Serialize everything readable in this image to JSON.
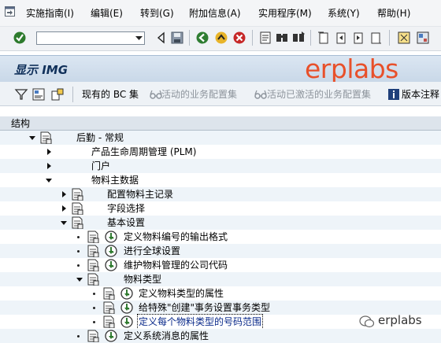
{
  "menu": {
    "items": [
      {
        "label": "实施指南(I)"
      },
      {
        "label": "编辑(E)"
      },
      {
        "label": "转到(G)"
      },
      {
        "label": "附加信息(A)"
      },
      {
        "label": "实用程序(M)"
      },
      {
        "label": "系统(Y)"
      },
      {
        "label": "帮助(H)"
      }
    ]
  },
  "command_field": {
    "value": ""
  },
  "title": "显示 IMG",
  "watermark": "erplabs",
  "app_toolbar": {
    "bc_sets": "现有的 BC 集",
    "active_bc_sets": "活动的业务配置集",
    "activated_bc_sets": "活动已激活的业务配置集",
    "release_notes": "版本注释"
  },
  "tree": {
    "header": "结构",
    "rows": [
      {
        "label": "后勤 - 常规"
      },
      {
        "label": "产品生命周期管理 (PLM)"
      },
      {
        "label": "门户"
      },
      {
        "label": "物料主数据"
      },
      {
        "label": "配置物料主记录"
      },
      {
        "label": "字段选择"
      },
      {
        "label": "基本设置"
      },
      {
        "label": "定义物料编号的输出格式"
      },
      {
        "label": "进行全球设置"
      },
      {
        "label": "维护物料管理的公司代码"
      },
      {
        "label": "物料类型"
      },
      {
        "label": "定义物料类型的属性"
      },
      {
        "label": "给特殊\"创建\"事务设置事务类型"
      },
      {
        "label": "定义每个物料类型的号码范围"
      },
      {
        "label": "定义系统消息的属性"
      }
    ]
  },
  "footer_watermark": "erplabs",
  "colors": {
    "watermark": "#e8502a",
    "title": "#10305a",
    "selection_text": "#0a2a8a"
  }
}
